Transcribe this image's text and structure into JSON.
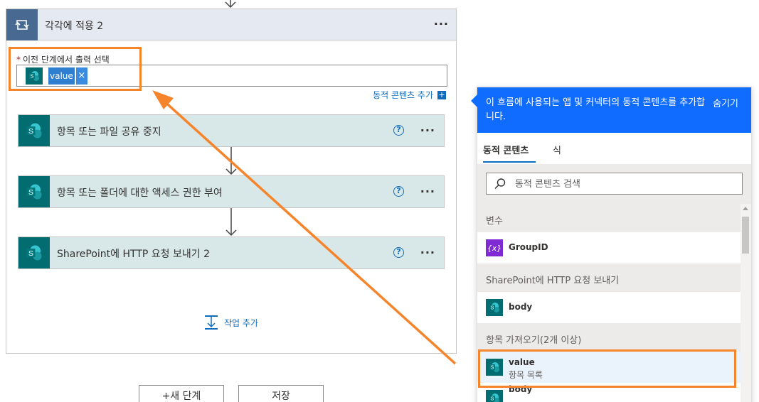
{
  "scope": {
    "title": "각각에 적용 2",
    "field_label": "이전 단계에서 출력 선택",
    "token_label": "value",
    "token_remove": "×",
    "add_dynamic": "동적 콘텐츠 추가",
    "add_dynamic_icon": "+",
    "more": "···"
  },
  "actions": [
    {
      "title": "항목 또는 파일 공유 중지",
      "help": "?",
      "more": "···"
    },
    {
      "title": "항목 또는 폴더에 대한 액세스 권한 부여",
      "help": "?",
      "more": "···"
    },
    {
      "title": "SharePoint에 HTTP 요청 보내기 2",
      "help": "?",
      "more": "···"
    }
  ],
  "add_action": "작업 추가",
  "buttons": {
    "new_step": "+새 단계",
    "save": "저장"
  },
  "panel": {
    "message": "이 흐름에 사용되는 앱 및 커넥터의 동적 콘텐츠를 추가합니다.",
    "hide": "숨기기",
    "tabs": [
      "동적 콘텐츠",
      "식"
    ],
    "search_placeholder": "동적 콘텐츠 검색",
    "sections": [
      {
        "title": "변수",
        "items": [
          {
            "name": "GroupID",
            "icon": "variable-icon",
            "glyph": "{x}"
          }
        ]
      },
      {
        "title": "SharePoint에 HTTP 요청 보내기",
        "items": [
          {
            "name": "body",
            "icon": "sharepoint-icon"
          }
        ]
      },
      {
        "title": "항목 가져오기(2개 이상)",
        "items": [
          {
            "name": "value",
            "sub": "항목 목록",
            "icon": "sharepoint-icon"
          },
          {
            "name": "body",
            "icon": "sharepoint-icon"
          }
        ]
      }
    ]
  },
  "colors": {
    "highlight": "#f6842b",
    "accent": "#0f6cff",
    "sharepoint": "#036c70",
    "scope": "#486991"
  }
}
